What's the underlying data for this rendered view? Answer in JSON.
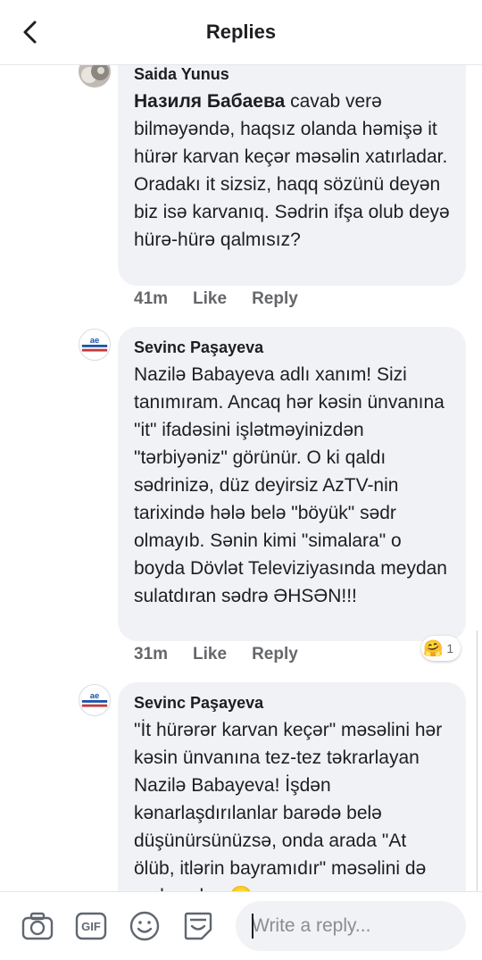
{
  "header": {
    "title": "Replies",
    "back_icon": "back-arrow-icon"
  },
  "comments": [
    {
      "author": "Saida Yunus",
      "mention": "Назиля Бабаева",
      "text": " cavab verə bilməyəndə, haqsız olanda həmişə it hürər karvan keçər məsəlin xatırladar. Oradakı it sizsiz, haqq sözünü deyən biz isə karvanıq. Sədrin ifşa olub deyə hürə-hürə qalmısız?",
      "time": "41m",
      "like_label": "Like",
      "reply_label": "Reply"
    },
    {
      "author": "Sevinc Paşayeva",
      "text": "Nazilə Babayeva adlı xanım! Sizi tanımıram. Ancaq hər kəsin ünvanına \"it\" ifadəsini işlətməyinizdən \"tərbiyəniz\" görünür. O ki qaldı sədrinizə, düz deyirsiz AzTV-nin tarixində hələ belə \"böyük\" sədr olmayıb. Sənin kimi \"simalara\" o boyda Dövlət Televiziyasında meydan sulatdıran sədrə ƏHSƏN!!!",
      "time": "31m",
      "like_label": "Like",
      "reply_label": "Reply",
      "reaction_count": "1",
      "reaction_icon": "hug-emoji-icon"
    },
    {
      "author": "Sevinc Paşayeva",
      "text": "\"İt hürərər karvan keçər\" məsəlini hər kəsin ünvanına tez-tez təkrarlayan Nazilə Babayeva! İşdən kənarlaşdırılanlar barədə belə düşünürsünüzsə, onda arada  \"At ölüb, itlərin bayramıdır\" məsəlini də yada salın. 😄"
    }
  ],
  "composer": {
    "placeholder": "Write a reply...",
    "tools": [
      "camera-icon",
      "gif-icon",
      "emoji-icon",
      "sticker-icon"
    ],
    "gif_label": "GIF"
  },
  "colors": {
    "bubble": "#f0f2f5",
    "meta_text": "#65676b",
    "text": "#1c1e21"
  }
}
